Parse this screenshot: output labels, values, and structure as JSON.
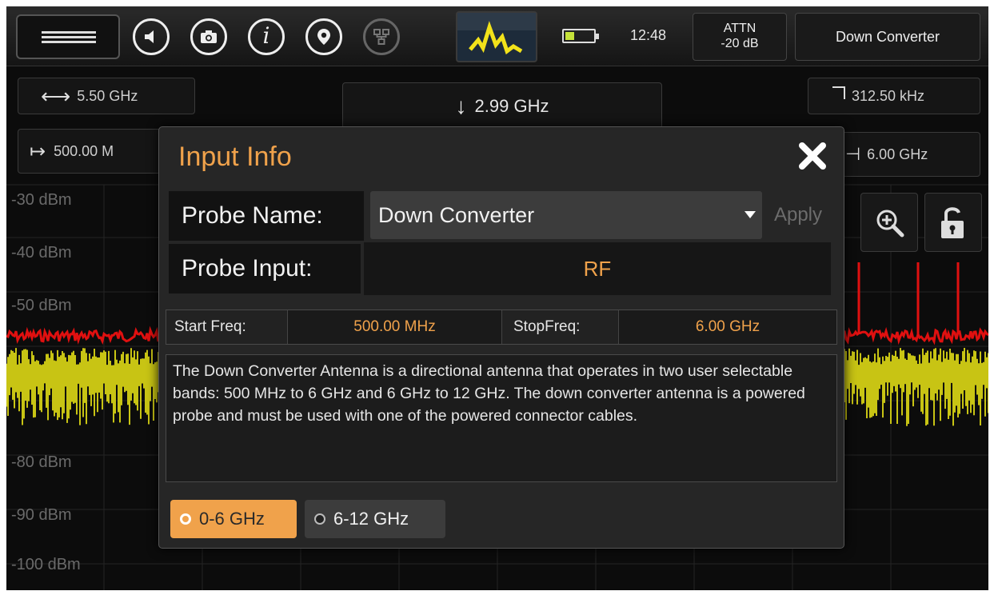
{
  "topbar": {
    "menu_icon": "hamburger-menu-icon",
    "icons": [
      "speaker-icon",
      "camera-icon",
      "info-icon",
      "location-pin-icon",
      "network-icon"
    ],
    "trace_icon": "spectrum-trace-icon",
    "battery_icon": "battery-icon",
    "time": "12:48",
    "attn_label": "ATTN",
    "attn_value": "-20 dB",
    "probe_button": "Down Converter"
  },
  "spectrum": {
    "span": "5.50 GHz",
    "center": "2.99 GHz",
    "rbw": "312.50 kHz",
    "start": "500.00 M",
    "stop": "6.00 GHz",
    "y_labels": [
      "-30 dBm",
      "-40 dBm",
      "-50 dBm",
      "-80 dBm",
      "-90 dBm",
      "-100 dBm"
    ],
    "colors": {
      "max_hold": "#e01010",
      "live": "#c8c414"
    },
    "side_icons": [
      "zoom-in-icon",
      "unlock-icon"
    ]
  },
  "modal": {
    "title": "Input Info",
    "probe_name_label": "Probe Name:",
    "probe_name_value": "Down Converter",
    "apply_label": "Apply",
    "probe_input_label": "Probe Input:",
    "probe_input_value": "RF",
    "start_freq_label": "Start Freq:",
    "start_freq_value": "500.00 MHz",
    "stop_freq_label": "StopFreq:",
    "stop_freq_value": "6.00 GHz",
    "description": "The Down Converter Antenna is a directional antenna that operates in two user selectable bands: 500 MHz to 6 GHz and 6 GHz to 12 GHz.  The down converter antenna is a powered probe and must be used with one of the powered connector cables.",
    "bands": [
      {
        "label": "0-6 GHz",
        "selected": true
      },
      {
        "label": "6-12 GHz",
        "selected": false
      }
    ],
    "accent_color": "#f0a24b"
  }
}
